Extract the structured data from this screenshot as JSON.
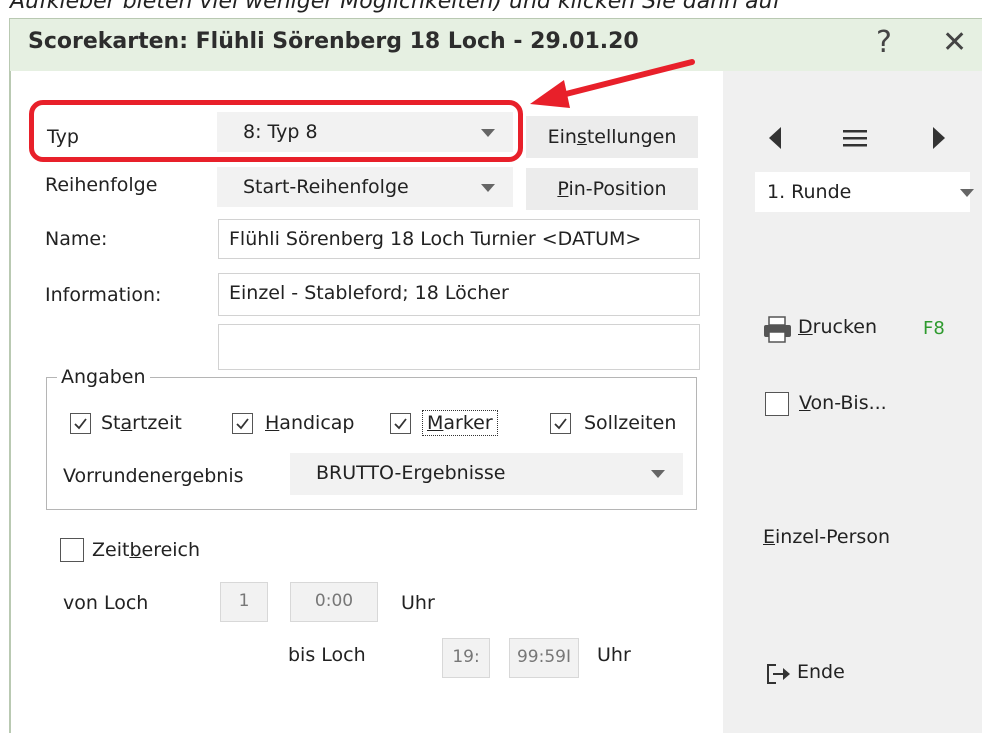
{
  "caption": "r Aufkleber bieten viel weniger Möglichkeiten) und klicken Sie dann auf",
  "window": {
    "title": "Scorekarten: Flühli Sörenberg 18 Loch - 29.01.20",
    "help_label": "?",
    "close_label": "✕"
  },
  "form": {
    "typ_label": "Typ",
    "typ_value": "8: Typ 8",
    "einstellungen_label": {
      "pre": "Ein",
      "u": "s",
      "post": "tellungen"
    },
    "reihenfolge_label": "Reihenfolge",
    "reihenfolge_value": "Start-Reihenfolge",
    "pin_position_label": {
      "pre": "",
      "u": "P",
      "post": "in-Position"
    },
    "name_label": "Name:",
    "name_value": "Flühli Sörenberg 18 Loch Turnier <DATUM>",
    "information_label": "Information:",
    "information_value": "Einzel - Stableford; 18 Löcher",
    "information_value2": ""
  },
  "angaben": {
    "legend": "Angaben",
    "startzeit": {
      "pre": "St",
      "u": "a",
      "post": "rtzeit",
      "checked": true
    },
    "handicap": {
      "pre": "",
      "u": "H",
      "post": "andicap",
      "checked": true
    },
    "marker": {
      "pre": "",
      "u": "M",
      "post": "arker",
      "checked": true
    },
    "sollzeiten": {
      "pre": "Sollzeiten",
      "u": "",
      "post": "",
      "checked": true
    },
    "vorrunden_label": "Vorrundenergebnis",
    "vorrunden_value": "BRUTTO-Ergebnisse"
  },
  "zeitbereich": {
    "label": {
      "pre": "Zeit",
      "u": "b",
      "post": "ereich"
    },
    "checked": false,
    "von_loch_label": "von Loch",
    "von_loch_value": "1",
    "von_time_value": "0:00",
    "uhr1": "Uhr",
    "bis_loch_label": "bis Loch",
    "bis_loch_value": "19:",
    "bis_time_value": "99:59I",
    "uhr2": "Uhr"
  },
  "sidebar": {
    "runde_value": "1. Runde",
    "drucken_label": {
      "pre": "",
      "u": "D",
      "post": "rucken"
    },
    "drucken_shortcut": "F8",
    "vonbis_label": {
      "pre": "",
      "u": "V",
      "post": "on-Bis..."
    },
    "einzel_label": {
      "pre": "",
      "u": "E",
      "post": "inzel-Person"
    },
    "ende_label": "Ende"
  },
  "colors": {
    "accent_red": "#e8202a",
    "titlebar_bg": "#e6f0e2",
    "shortcut_green": "#2e9a2e"
  }
}
